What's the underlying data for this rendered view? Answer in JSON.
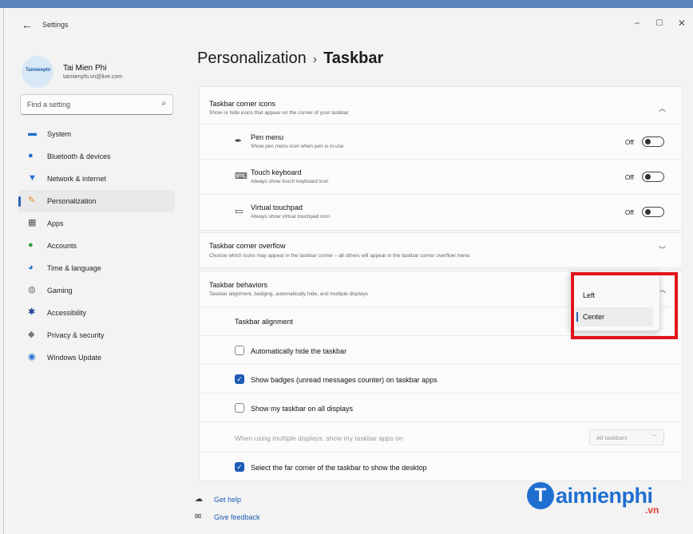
{
  "window": {
    "app_title": "Settings",
    "back_icon": "back-arrow-icon",
    "controls": [
      "minimize-icon",
      "maximize-icon",
      "close-icon"
    ]
  },
  "profile": {
    "logo_text": "Taimienphi",
    "name": "Tai Mien Phi",
    "email": "taimienphi.vn@live.com"
  },
  "search": {
    "placeholder": "Find a setting",
    "icon": "search-icon"
  },
  "sidebar": {
    "items": [
      {
        "label": "System",
        "icon": "system-icon",
        "color": "#1e6fd0"
      },
      {
        "label": "Bluetooth & devices",
        "icon": "bluetooth-icon",
        "color": "#1e6fd0"
      },
      {
        "label": "Network & internet",
        "icon": "wifi-icon",
        "color": "#1e6fd0"
      },
      {
        "label": "Personalization",
        "icon": "brush-icon",
        "color": "#e08a2a",
        "active": true
      },
      {
        "label": "Apps",
        "icon": "apps-icon",
        "color": "#555555"
      },
      {
        "label": "Accounts",
        "icon": "account-icon",
        "color": "#2ea043"
      },
      {
        "label": "Time & language",
        "icon": "globe-icon",
        "color": "#1e6fd0"
      },
      {
        "label": "Gaming",
        "icon": "gamepad-icon",
        "color": "#777777"
      },
      {
        "label": "Accessibility",
        "icon": "accessibility-icon",
        "color": "#1a3d8f"
      },
      {
        "label": "Privacy & security",
        "icon": "shield-icon",
        "color": "#777777"
      },
      {
        "label": "Windows Update",
        "icon": "update-icon",
        "color": "#1e6fd0"
      }
    ]
  },
  "breadcrumb": {
    "parent": "Personalization",
    "separator": "›",
    "current": "Taskbar"
  },
  "corner_icons": {
    "title": "Taskbar corner icons",
    "desc": "Show or hide icons that appear on the corner of your taskbar",
    "chevron": "chevron-up-icon",
    "rows": [
      {
        "title": "Pen menu",
        "desc": "Show pen menu icon when pen is in use",
        "state": "Off",
        "icon": "pen-icon"
      },
      {
        "title": "Touch keyboard",
        "desc": "Always show touch keyboard icon",
        "state": "Off",
        "icon": "keyboard-icon"
      },
      {
        "title": "Virtual touchpad",
        "desc": "Always show virtual touchpad icon",
        "state": "Off",
        "icon": "touchpad-icon"
      }
    ]
  },
  "corner_overflow": {
    "title": "Taskbar corner overflow",
    "desc": "Choose which icons may appear in the taskbar corner – all others will appear in the taskbar corner overflow menu",
    "chevron": "chevron-down-icon"
  },
  "behaviors": {
    "title": "Taskbar behaviors",
    "desc": "Taskbar alignment, badging, automatically hide, and multiple displays",
    "alignment_label": "Taskbar alignment",
    "auto_hide": {
      "label": "Automatically hide the taskbar",
      "checked": false
    },
    "badges": {
      "label": "Show badges (unread messages counter) on taskbar apps",
      "checked": true
    },
    "all_displays": {
      "label": "Show my taskbar on all displays",
      "checked": false
    },
    "multi_display": {
      "label": "When using multiple displays, show my taskbar apps on",
      "value": "All taskbars"
    },
    "far_corner": {
      "label": "Select the far corner of the taskbar to show the desktop",
      "checked": true
    }
  },
  "alignment_dropdown": {
    "options": [
      "Left",
      "Center"
    ],
    "selected": "Center",
    "highlight_color": "#e2131b"
  },
  "footer": {
    "get_help": "Get help",
    "give_feedback": "Give feedback"
  },
  "watermark": {
    "letter": "T",
    "text": "aimienphi",
    "suffix": ".vn"
  }
}
